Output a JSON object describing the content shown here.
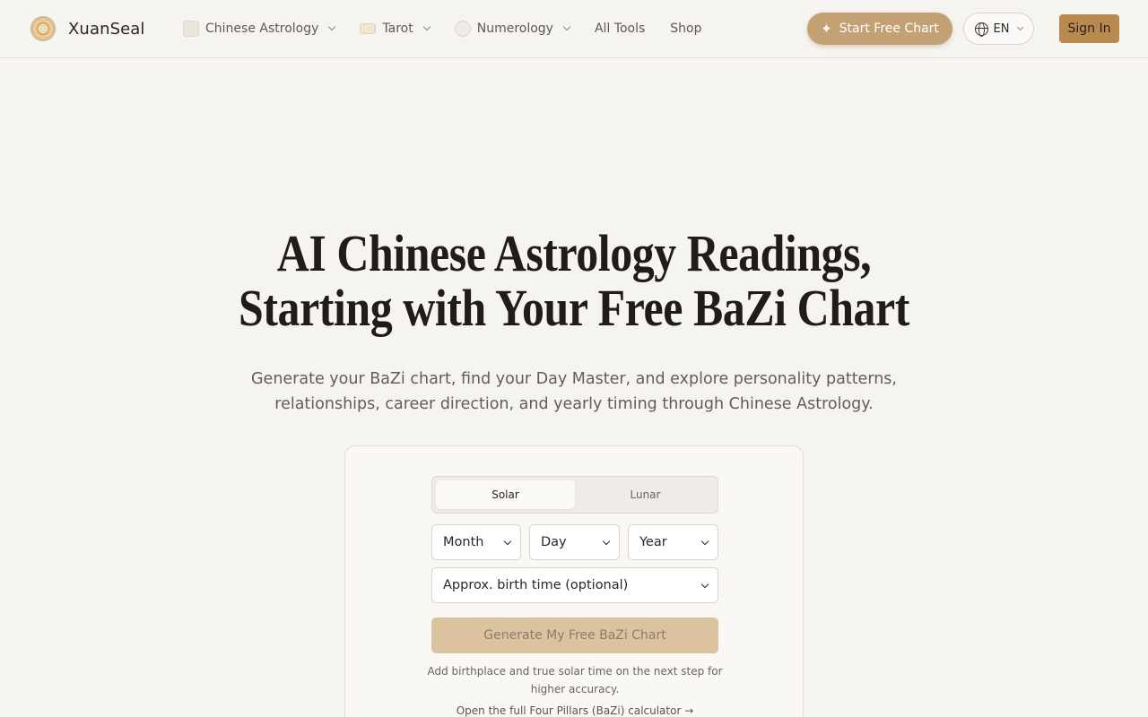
{
  "brand": {
    "name": "XuanSeal",
    "logo_icon": "seal-logo-icon"
  },
  "nav": {
    "items": [
      {
        "label": "Chinese Astrology",
        "icon": "astrology-icon",
        "has_dropdown": true
      },
      {
        "label": "Tarot",
        "icon": "tarot-icon",
        "has_dropdown": true
      },
      {
        "label": "Numerology",
        "icon": "numerology-icon",
        "has_dropdown": true
      },
      {
        "label": "All Tools",
        "has_dropdown": false
      },
      {
        "label": "Shop",
        "has_dropdown": false
      }
    ]
  },
  "header_actions": {
    "start_label": "Start Free Chart",
    "lang_label": "EN",
    "signin_label": "Sign In"
  },
  "hero": {
    "title_line1": "AI Chinese Astrology Readings,",
    "title_line2": "Starting with Your Free BaZi Chart",
    "subtitle_line1": "Generate your BaZi chart, find your Day Master, and explore personality patterns,",
    "subtitle_line2": "relationships, career direction, and yearly timing through Chinese Astrology."
  },
  "form": {
    "calendar_tabs": [
      {
        "label": "Solar",
        "active": true
      },
      {
        "label": "Lunar",
        "active": false
      }
    ],
    "month": {
      "value": "Month"
    },
    "day": {
      "value": "Day"
    },
    "year": {
      "value": "Year"
    },
    "time": {
      "value": "Approx. birth time (optional)"
    },
    "submit_label": "Generate My Free BaZi Chart",
    "note_line1": "Add birthplace and true solar time on the next step for",
    "note_line2": "higher accuracy.",
    "full_link": "Open the full Four Pillars (BaZi) calculator →"
  },
  "colors": {
    "background": "#f6f4f0",
    "accent": "#c4a075",
    "signin": "#b88a4f",
    "generate_disabled": "#dcc3a0"
  }
}
